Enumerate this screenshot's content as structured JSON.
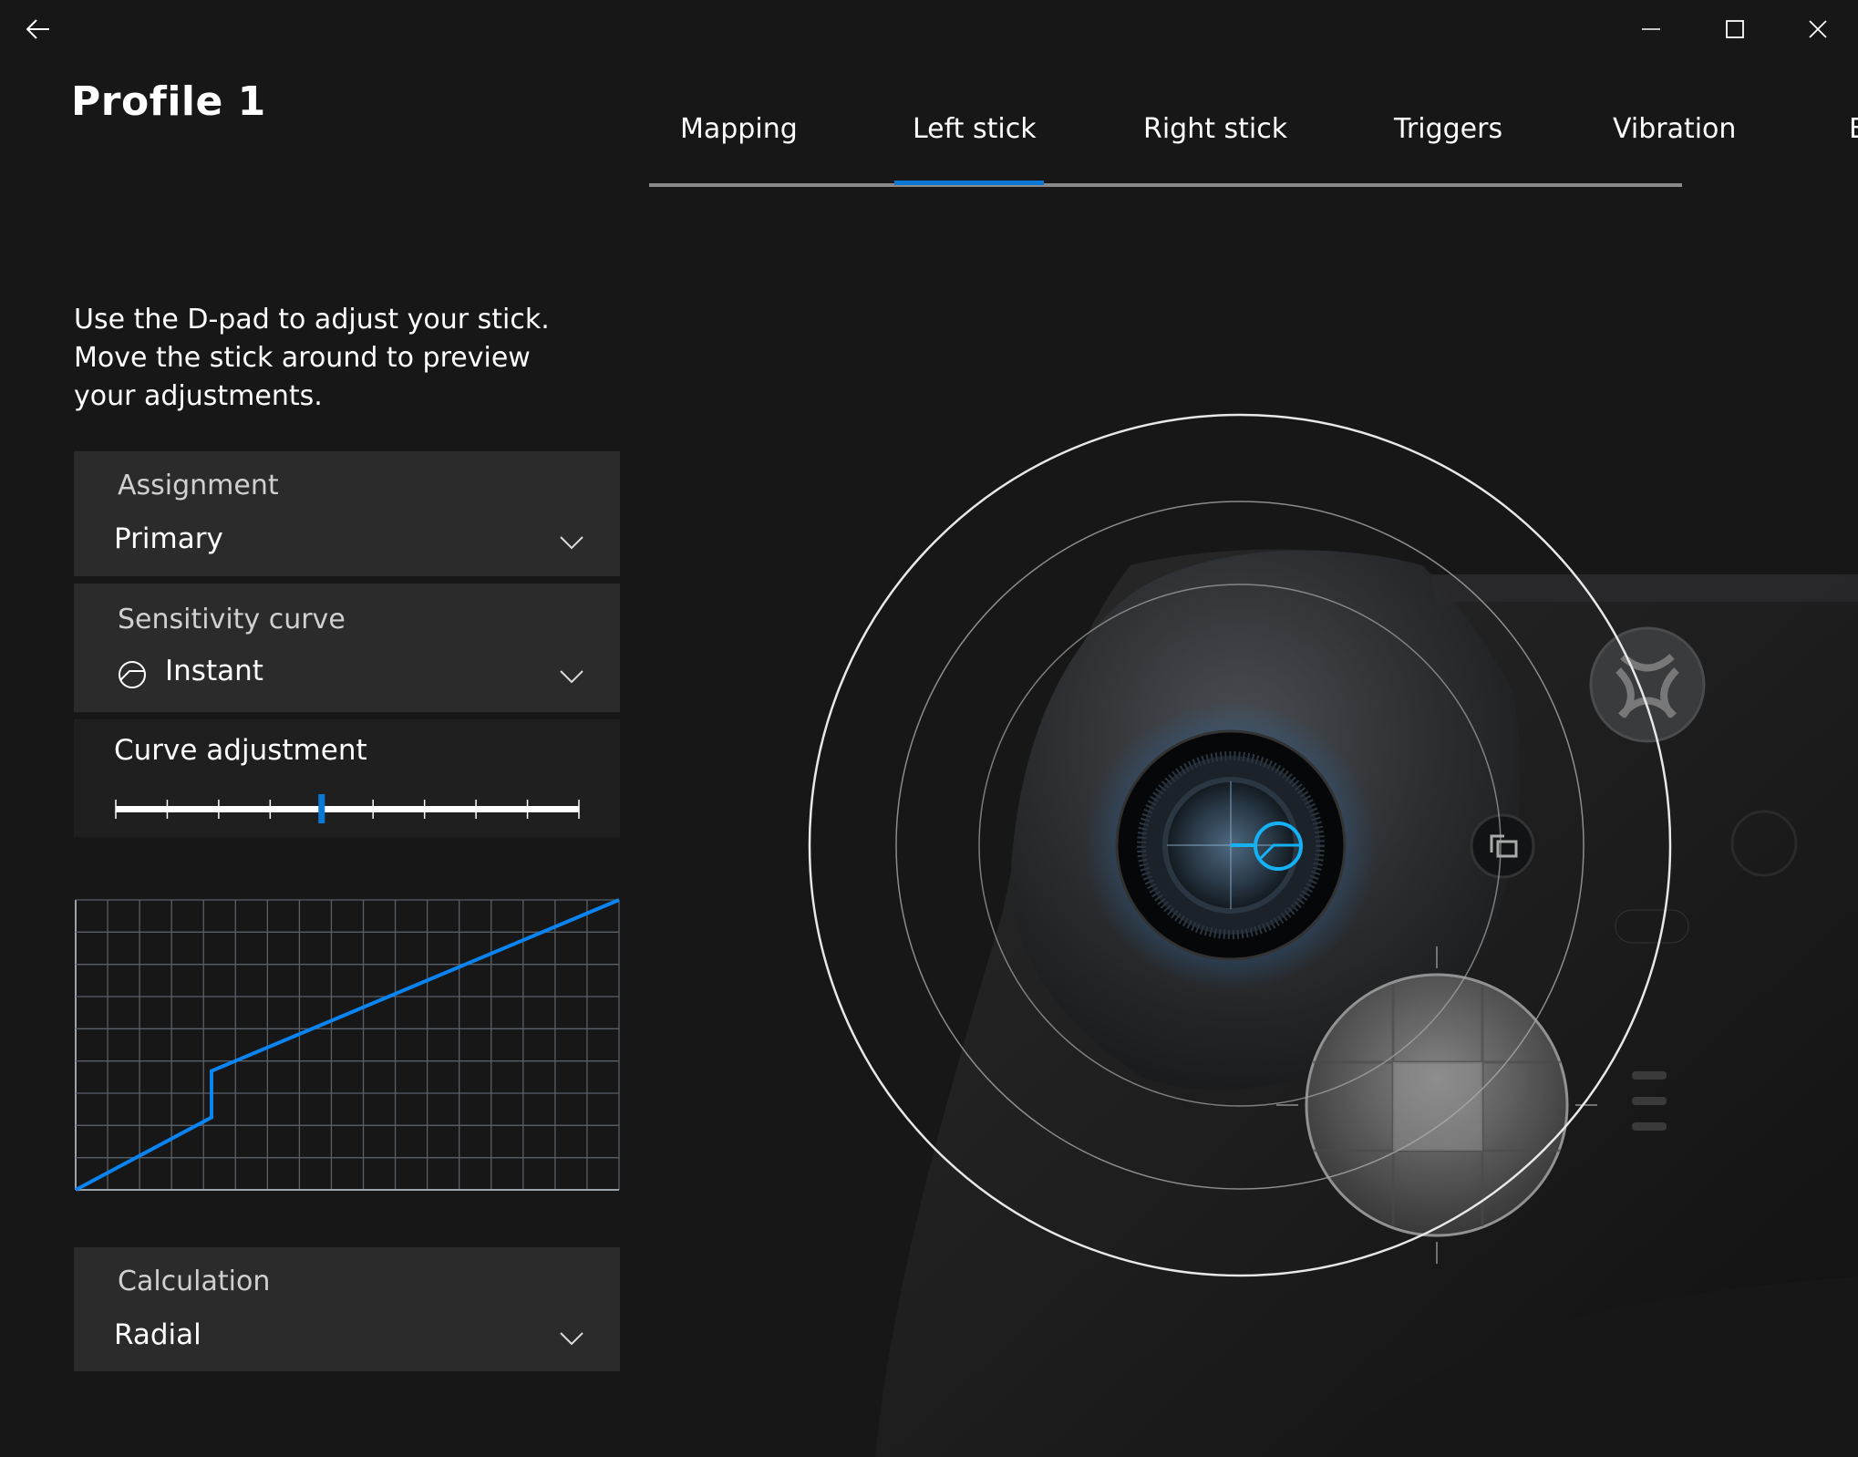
{
  "window": {
    "back_icon": "arrow-left-icon",
    "controls": [
      "minimize-icon",
      "maximize-icon",
      "close-icon"
    ]
  },
  "header": {
    "title": "Profile 1"
  },
  "tabs": [
    {
      "label": "Mapping",
      "active": false
    },
    {
      "label": "Left stick",
      "active": true
    },
    {
      "label": "Right stick",
      "active": false
    },
    {
      "label": "Triggers",
      "active": false
    },
    {
      "label": "Vibration",
      "active": false
    },
    {
      "label": "B",
      "active": false
    }
  ],
  "accent_color": "#0a78d4",
  "instructions": {
    "line1": "Use the D-pad to adjust your stick.",
    "line2": "Move the stick around to preview",
    "line3": "your adjustments."
  },
  "assignment": {
    "label": "Assignment",
    "value": "Primary"
  },
  "sensitivity": {
    "label": "Sensitivity curve",
    "value": "Instant",
    "icon": "instant-curve-icon"
  },
  "curve_adjustment": {
    "label": "Curve adjustment",
    "steps": 10,
    "value_index": 4
  },
  "chart_data": {
    "type": "line",
    "grid": true,
    "grid_columns": 17,
    "grid_rows": 9,
    "xlim": [
      0,
      1
    ],
    "ylim": [
      0,
      1
    ],
    "series": [
      {
        "color": "#0a84f0",
        "points": [
          [
            0,
            0
          ],
          [
            0.25,
            0.25
          ],
          [
            0.25,
            0.41
          ],
          [
            1,
            1
          ]
        ]
      }
    ]
  },
  "calculation": {
    "label": "Calculation",
    "value": "Radial"
  }
}
